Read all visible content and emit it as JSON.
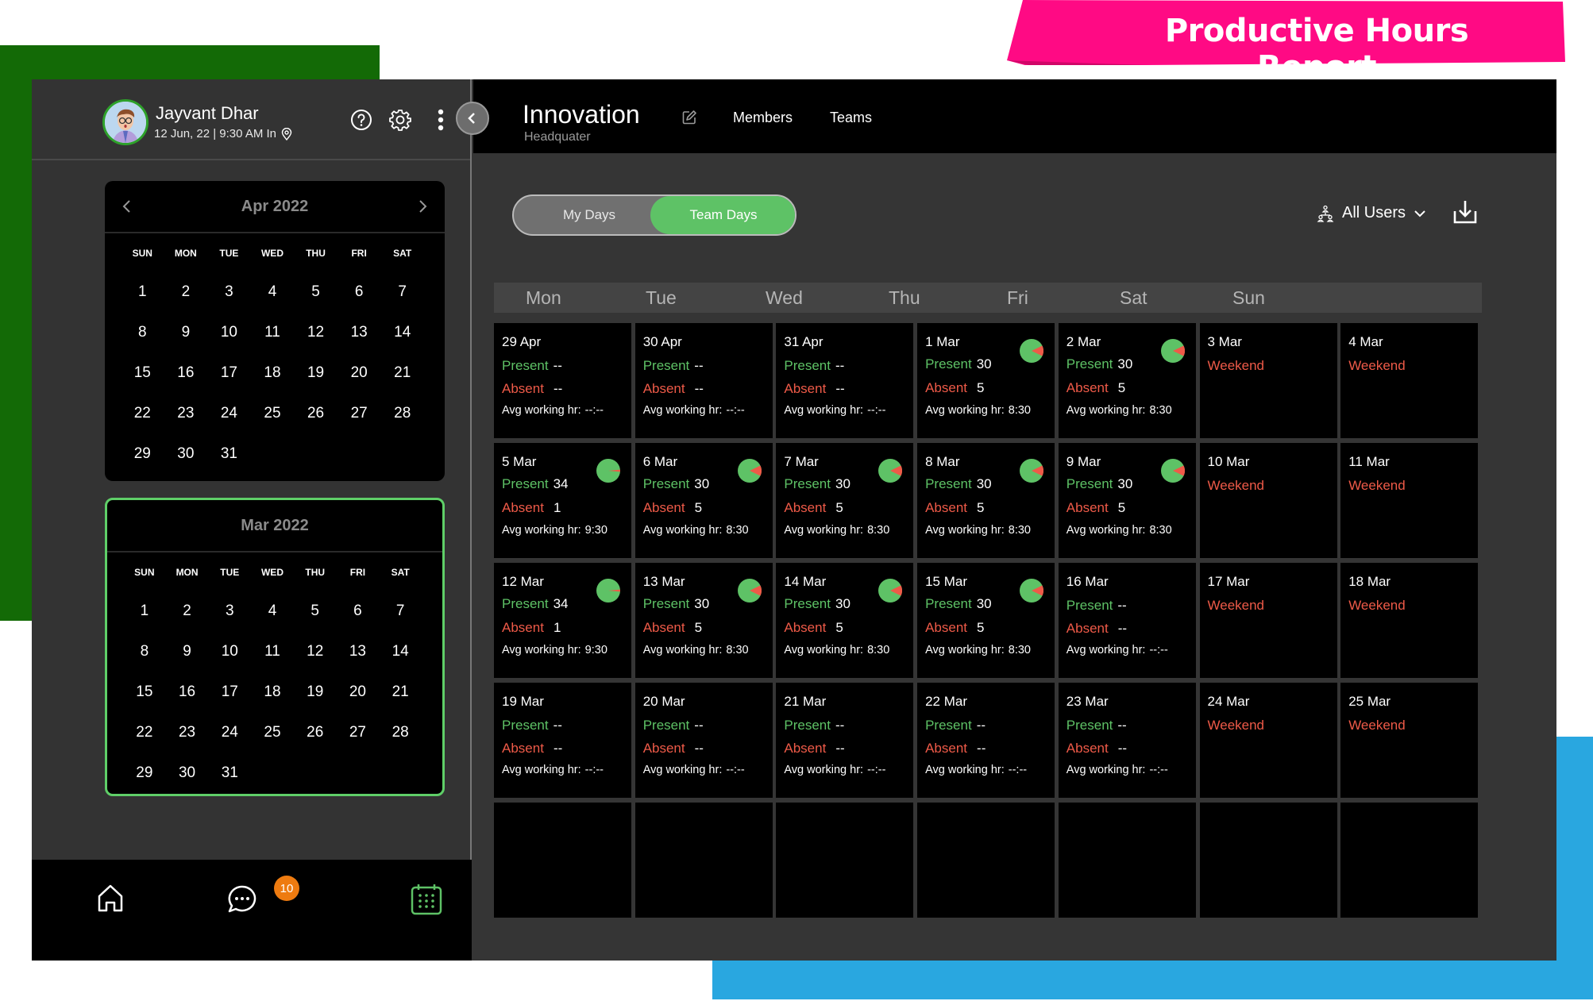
{
  "banner": {
    "title": "Productive Hours Report"
  },
  "user": {
    "name": "Jayvant Dhar",
    "meta": "12 Jun, 22 | 9:30 AM In"
  },
  "header_icons": [
    "help-icon",
    "gear-icon",
    "more-vertical-icon"
  ],
  "calendars": [
    {
      "title": "Apr 2022",
      "show_nav": true,
      "weekdays": [
        "SUN",
        "MON",
        "TUE",
        "WED",
        "THU",
        "FRI",
        "SAT"
      ],
      "days": [
        "1",
        "2",
        "3",
        "4",
        "5",
        "6",
        "7",
        "8",
        "9",
        "10",
        "11",
        "12",
        "13",
        "14",
        "15",
        "16",
        "17",
        "18",
        "19",
        "20",
        "21",
        "22",
        "23",
        "24",
        "25",
        "26",
        "27",
        "28",
        "29",
        "30",
        "31"
      ]
    },
    {
      "title": "Mar 2022",
      "show_nav": false,
      "selected": true,
      "weekdays": [
        "SUN",
        "MON",
        "TUE",
        "WED",
        "THU",
        "FRI",
        "SAT"
      ],
      "days": [
        "1",
        "2",
        "3",
        "4",
        "5",
        "6",
        "7",
        "8",
        "9",
        "10",
        "11",
        "12",
        "13",
        "14",
        "15",
        "16",
        "17",
        "18",
        "19",
        "20",
        "21",
        "22",
        "23",
        "24",
        "25",
        "26",
        "27",
        "28",
        "29",
        "30",
        "31"
      ]
    }
  ],
  "bottom_nav": {
    "items": [
      "home-icon",
      "chat-icon",
      "calendar-icon"
    ],
    "active": "calendar-icon",
    "chat_badge": "10"
  },
  "workspace": {
    "title": "Innovation",
    "subtitle": "Headquater"
  },
  "top_links": [
    "Members",
    "Teams"
  ],
  "toggle": {
    "options": [
      "My Days",
      "Team Days"
    ],
    "selected": "Team Days"
  },
  "filter": {
    "label": "All Users"
  },
  "colors": {
    "present": "#5ec266",
    "absent": "#ee5a48",
    "accent": "#5ec266",
    "badge": "#ee7b10"
  },
  "weekdays": [
    "Mon",
    "Tue",
    "Wed",
    "Thu",
    "Fri",
    "Sat",
    "Sun"
  ],
  "labels": {
    "present": "Present",
    "absent": "Absent",
    "avg": "Avg working hr:",
    "weekend": "Weekend"
  },
  "weeks": [
    [
      {
        "date": "29 Apr",
        "present": "--",
        "absent": "--",
        "avg": "--:--"
      },
      {
        "date": "30 Apr",
        "present": "--",
        "absent": "--",
        "avg": "--:--"
      },
      {
        "date": "31 Apr",
        "present": "--",
        "absent": "--",
        "avg": "--:--"
      },
      {
        "date": "1 Mar",
        "present": "30",
        "absent": "5",
        "avg": "8:30",
        "chart": true
      },
      {
        "date": "2 Mar",
        "present": "30",
        "absent": "5",
        "avg": "8:30",
        "chart": true
      },
      {
        "date": "3 Mar",
        "weekend": true
      },
      {
        "date": "4 Mar",
        "weekend": true
      }
    ],
    [
      {
        "date": "5 Mar",
        "present": "34",
        "absent": "1",
        "avg": "9:30",
        "chart": true
      },
      {
        "date": "6 Mar",
        "present": "30",
        "absent": "5",
        "avg": "8:30",
        "chart": true
      },
      {
        "date": "7 Mar",
        "present": "30",
        "absent": "5",
        "avg": "8:30",
        "chart": true
      },
      {
        "date": "8 Mar",
        "present": "30",
        "absent": "5",
        "avg": "8:30",
        "chart": true
      },
      {
        "date": "9 Mar",
        "present": "30",
        "absent": "5",
        "avg": "8:30",
        "chart": true
      },
      {
        "date": "10 Mar",
        "weekend": true
      },
      {
        "date": "11 Mar",
        "weekend": true
      }
    ],
    [
      {
        "date": "12 Mar",
        "present": "34",
        "absent": "1",
        "avg": "9:30",
        "chart": true
      },
      {
        "date": "13 Mar",
        "present": "30",
        "absent": "5",
        "avg": "8:30",
        "chart": true
      },
      {
        "date": "14 Mar",
        "present": "30",
        "absent": "5",
        "avg": "8:30",
        "chart": true
      },
      {
        "date": "15 Mar",
        "present": "30",
        "absent": "5",
        "avg": "8:30",
        "chart": true
      },
      {
        "date": "16 Mar",
        "present": "--",
        "absent": "--",
        "avg": "--:--"
      },
      {
        "date": "17 Mar",
        "weekend": true
      },
      {
        "date": "18 Mar",
        "weekend": true
      }
    ],
    [
      {
        "date": "19 Mar",
        "present": "--",
        "absent": "--",
        "avg": "--:--"
      },
      {
        "date": "20 Mar",
        "present": "--",
        "absent": "--",
        "avg": "--:--"
      },
      {
        "date": "21 Mar",
        "present": "--",
        "absent": "--",
        "avg": "--:--"
      },
      {
        "date": "22 Mar",
        "present": "--",
        "absent": "--",
        "avg": "--:--"
      },
      {
        "date": "23 Mar",
        "present": "--",
        "absent": "--",
        "avg": "--:--"
      },
      {
        "date": "24 Mar",
        "weekend": true
      },
      {
        "date": "25 Mar",
        "weekend": true
      }
    ],
    [
      {},
      {},
      {},
      {},
      {},
      {},
      {}
    ]
  ]
}
